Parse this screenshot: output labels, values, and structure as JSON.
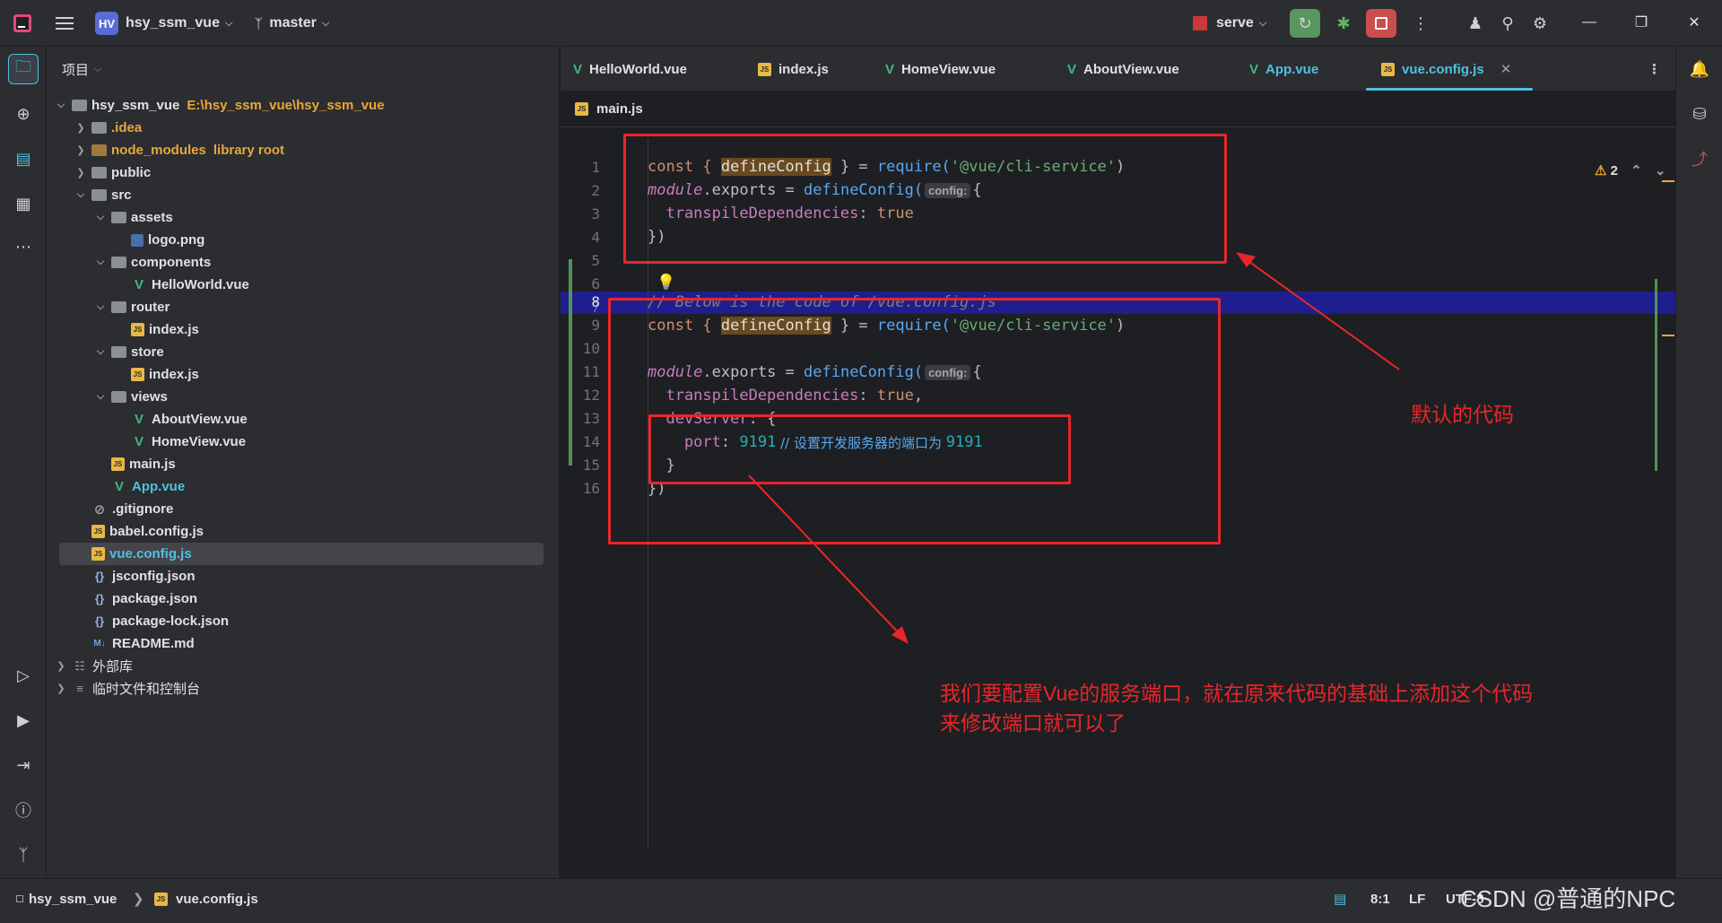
{
  "titlebar": {
    "project_badge": "HV",
    "project_name": "hsy_ssm_vue",
    "branch": "master",
    "run_config": "serve"
  },
  "project_panel": {
    "header": "项目",
    "tree": [
      {
        "label": "hsy_ssm_vue",
        "extra": "E:\\hsy_ssm_vue\\hsy_ssm_vue"
      },
      {
        "label": ".idea"
      },
      {
        "label": "node_modules",
        "extra": "library root"
      },
      {
        "label": "public"
      },
      {
        "label": "src"
      },
      {
        "label": "assets"
      },
      {
        "label": "logo.png"
      },
      {
        "label": "components"
      },
      {
        "label": "HelloWorld.vue"
      },
      {
        "label": "router"
      },
      {
        "label": "index.js"
      },
      {
        "label": "store"
      },
      {
        "label": "index.js"
      },
      {
        "label": "views"
      },
      {
        "label": "AboutView.vue"
      },
      {
        "label": "HomeView.vue"
      },
      {
        "label": "main.js"
      },
      {
        "label": "App.vue"
      },
      {
        "label": ".gitignore"
      },
      {
        "label": "babel.config.js"
      },
      {
        "label": "vue.config.js"
      },
      {
        "label": "jsconfig.json"
      },
      {
        "label": "package.json"
      },
      {
        "label": "package-lock.json"
      },
      {
        "label": "README.md"
      },
      {
        "label": "外部库"
      },
      {
        "label": "临时文件和控制台"
      }
    ]
  },
  "tabs": [
    {
      "label": "HelloWorld.vue"
    },
    {
      "label": "index.js"
    },
    {
      "label": "HomeView.vue"
    },
    {
      "label": "AboutView.vue"
    },
    {
      "label": "App.vue"
    },
    {
      "label": "vue.config.js"
    }
  ],
  "breadcrumb": "main.js",
  "editor": {
    "warning_count": "2",
    "line_numbers": [
      "1",
      "2",
      "3",
      "4",
      "5",
      "6",
      "7",
      "8",
      "9",
      "10",
      "11",
      "12",
      "13",
      "14",
      "15",
      "16"
    ],
    "code": {
      "l1_a": "const { ",
      "l1_b": "defineConfig",
      "l1_c": " } = ",
      "l1_d": "require(",
      "l1_e": "'@vue/cli-service'",
      "l1_f": ")",
      "l2_a": "module",
      "l2_b": ".exports = ",
      "l2_c": "defineConfig(",
      "l2_hint": "config:",
      "l2_d": "{",
      "l3_a": "  transpileDependencies",
      "l3_b": ": ",
      "l3_c": "true",
      "l4": "})",
      "l8": "// Below is the code of /vue.config.js",
      "l9_a": "const { ",
      "l9_b": "defineConfig",
      "l9_c": " } = ",
      "l9_d": "require(",
      "l9_e": "'@vue/cli-service'",
      "l9_f": ")",
      "l11_a": "module",
      "l11_b": ".exports = ",
      "l11_c": "defineConfig(",
      "l11_hint": "config:",
      "l11_d": "{",
      "l12_a": "  transpileDependencies",
      "l12_b": ": ",
      "l12_c": "true",
      "l12_d": ",",
      "l13_a": "  devServer",
      "l13_b": ": {",
      "l14_a": "    port",
      "l14_b": ": ",
      "l14_c": "9191",
      "l14_d": " // 设置开发服务器的端口为 ",
      "l14_e": "9191",
      "l15": "  }",
      "l16": "})"
    }
  },
  "annotations": {
    "default_code": "默认的代码",
    "explain_line1": "我们要配置Vue的服务端口，就在原来代码的基础上添加这个代码",
    "explain_line2": "来修改端口就可以了"
  },
  "statusbar": {
    "project": "hsy_ssm_vue",
    "file": "vue.config.js",
    "position": "8:1",
    "line_sep": "LF",
    "encoding": "UTF-8",
    "watermark": "CSDN @普通的NPC"
  },
  "colors": {
    "accent": "#4fc1e0",
    "annotation_red": "#e8262a",
    "folder_library": "#e8a73a"
  }
}
